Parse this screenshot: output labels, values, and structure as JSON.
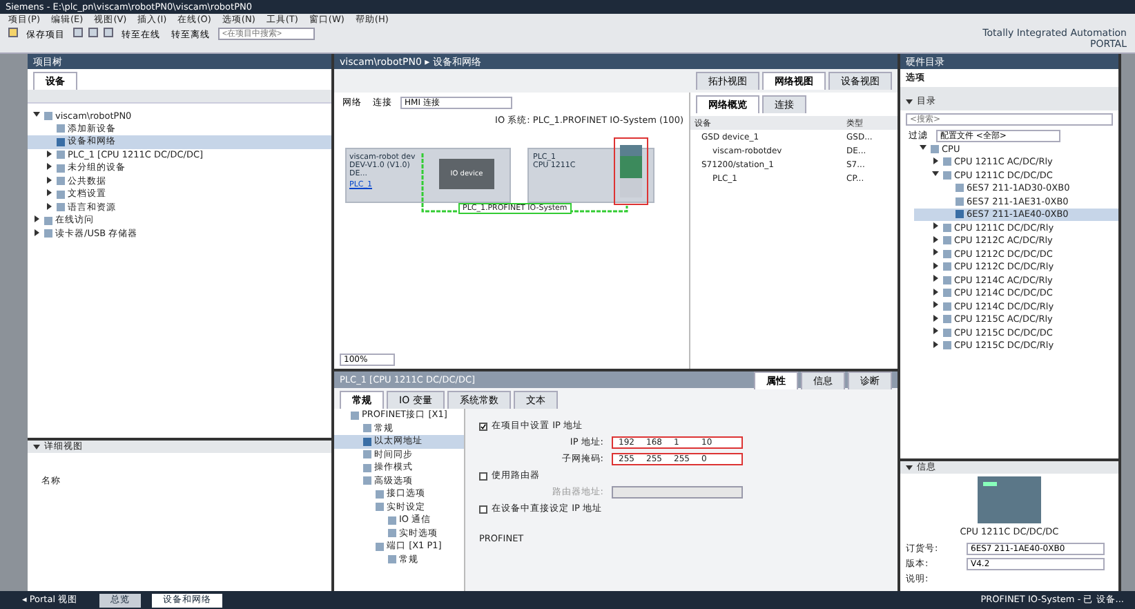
{
  "window": {
    "title": "Siemens - E:\\plc_pn\\viscam\\robotPN0\\viscam\\robotPN0",
    "brand_line1": "Totally Integrated Automation",
    "brand_line2": "PORTAL"
  },
  "menu": [
    "项目(P)",
    "编辑(E)",
    "视图(V)",
    "插入(I)",
    "在线(O)",
    "选项(N)",
    "工具(T)",
    "窗口(W)",
    "帮助(H)"
  ],
  "toolbar": {
    "save_label": "保存项目",
    "online_label": "转至在线",
    "offline_label": "转至离线",
    "search_placeholder": "<在项目中搜索>"
  },
  "project_tree": {
    "title": "项目树",
    "tab": "设备",
    "items": [
      {
        "label": "viscam\\robotPN0",
        "expanded": true,
        "selected": false,
        "children": [
          {
            "label": "添加新设备",
            "selected": false
          },
          {
            "label": "设备和网络",
            "selected": true
          },
          {
            "label": "PLC_1 [CPU 1211C DC/DC/DC]",
            "expanded": false,
            "selected": false
          },
          {
            "label": "未分组的设备",
            "expanded": false,
            "selected": false
          },
          {
            "label": "公共数据",
            "expanded": false,
            "selected": false
          },
          {
            "label": "文档设置",
            "expanded": false,
            "selected": false
          },
          {
            "label": "语言和资源",
            "expanded": false,
            "selected": false
          }
        ]
      },
      {
        "label": "在线访问",
        "expanded": false,
        "selected": false
      },
      {
        "label": "读卡器/USB 存储器",
        "expanded": false,
        "selected": false
      }
    ]
  },
  "details": {
    "title": "详细视图",
    "column": "名称"
  },
  "editor": {
    "breadcrumb": "viscam\\robotPN0 ▸ 设备和网络",
    "view_tabs": [
      {
        "label": "拓扑视图",
        "selected": false
      },
      {
        "label": "网络视图",
        "selected": true
      },
      {
        "label": "设备视图",
        "selected": false
      }
    ],
    "tools": [
      "网络",
      "连接"
    ],
    "connection_select": "HMI 连接",
    "io_system": "IO 系统: PLC_1.PROFINET IO-System (100)",
    "devices": [
      {
        "name": "viscam-robot dev",
        "type": "DEV-V1.0 (V1.0) DE...",
        "link": "PLC_1",
        "module": "IO device"
      },
      {
        "name": "PLC_1",
        "type": "CPU 1211C"
      }
    ],
    "network_label": "PLC_1.PROFINET IO-System",
    "zoom": "100%"
  },
  "overview": {
    "tabs": [
      {
        "label": "网络概览",
        "selected": true
      },
      {
        "label": "连接",
        "selected": false
      }
    ],
    "columns": [
      "设备",
      "类型"
    ],
    "rows": [
      {
        "device": "GSD device_1",
        "type": "GSD..."
      },
      {
        "device": "viscam-robotdev",
        "type": "DE..."
      },
      {
        "device": "S71200/station_1",
        "type": "S7..."
      },
      {
        "device": "PLC_1",
        "type": "CP..."
      }
    ]
  },
  "inspector": {
    "title": "PLC_1 [CPU 1211C DC/DC/DC]",
    "tabs": [
      {
        "label": "属性",
        "selected": true
      },
      {
        "label": "信息",
        "selected": false
      },
      {
        "label": "诊断",
        "selected": false
      }
    ],
    "subtabs": [
      {
        "label": "常规",
        "selected": true
      },
      {
        "label": "IO 变量",
        "selected": false
      },
      {
        "label": "系统常数",
        "selected": false
      },
      {
        "label": "文本",
        "selected": false
      }
    ],
    "nav": [
      {
        "label": "PROFINET接口 [X1]",
        "selected": false,
        "children": [
          {
            "label": "常规",
            "selected": false
          },
          {
            "label": "以太网地址",
            "selected": true
          },
          {
            "label": "时间同步",
            "selected": false
          },
          {
            "label": "操作模式",
            "selected": false
          },
          {
            "label": "高级选项",
            "selected": false,
            "children": [
              {
                "label": "接口选项",
                "selected": false
              },
              {
                "label": "实时设定",
                "selected": false,
                "children": [
                  {
                    "label": "IO 通信",
                    "selected": false
                  },
                  {
                    "label": "实时选项",
                    "selected": false
                  }
                ]
              },
              {
                "label": "端口 [X1 P1]",
                "selected": false,
                "children": [
                  {
                    "label": "常规",
                    "selected": false
                  }
                ]
              }
            ]
          }
        ]
      }
    ],
    "set_ip": {
      "label": "在项目中设置 IP 地址",
      "checked": true
    },
    "ip_label": "IP 地址:",
    "ip": [
      "192",
      "168",
      "1",
      "10"
    ],
    "mask_label": "子网掩码:",
    "mask": [
      "255",
      "255",
      "255",
      "0"
    ],
    "router": {
      "label": "使用路由器",
      "checked": false
    },
    "router_label": "路由器地址:",
    "direct": {
      "label": "在设备中直接设定 IP 地址",
      "checked": false
    },
    "section": "PROFINET"
  },
  "catalog": {
    "title": "硬件目录",
    "options": "选项",
    "section": "目录",
    "search_placeholder": "<搜索>",
    "filter_label": "过滤",
    "profile": "配置文件 <全部>",
    "items": [
      {
        "label": "CPU",
        "expanded": true,
        "selected": false,
        "children": [
          {
            "label": "CPU 1211C AC/DC/Rly",
            "expanded": false,
            "selected": false
          },
          {
            "label": "CPU 1211C DC/DC/DC",
            "expanded": true,
            "selected": false,
            "children": [
              {
                "label": "6ES7 211-1AD30-0XB0",
                "selected": false
              },
              {
                "label": "6ES7 211-1AE31-0XB0",
                "selected": false
              },
              {
                "label": "6ES7 211-1AE40-0XB0",
                "selected": true
              }
            ]
          },
          {
            "label": "CPU 1211C DC/DC/Rly",
            "expanded": false,
            "selected": false
          },
          {
            "label": "CPU 1212C AC/DC/Rly",
            "expanded": false,
            "selected": false
          },
          {
            "label": "CPU 1212C DC/DC/DC",
            "expanded": false,
            "selected": false
          },
          {
            "label": "CPU 1212C DC/DC/Rly",
            "expanded": false,
            "selected": false
          },
          {
            "label": "CPU 1214C AC/DC/Rly",
            "expanded": false,
            "selected": false
          },
          {
            "label": "CPU 1214C DC/DC/DC",
            "expanded": false,
            "selected": false
          },
          {
            "label": "CPU 1214C DC/DC/Rly",
            "expanded": false,
            "selected": false
          },
          {
            "label": "CPU 1215C AC/DC/Rly",
            "expanded": false,
            "selected": false
          },
          {
            "label": "CPU 1215C DC/DC/DC",
            "expanded": false,
            "selected": false
          },
          {
            "label": "CPU 1215C DC/DC/Rly",
            "expanded": false,
            "selected": false
          }
        ]
      }
    ],
    "info_title": "信息",
    "device_name": "CPU 1211C DC/DC/DC",
    "order_label": "订货号:",
    "order": "6ES7 211-1AE40-0XB0",
    "version_label": "版本:",
    "version": "V4.2",
    "desc_label": "说明:"
  },
  "taskbar": {
    "portal": "◂ Portal 视图",
    "tabs": [
      {
        "label": "总览",
        "selected": false
      },
      {
        "label": "设备和网络",
        "selected": true
      }
    ],
    "status": "PROFINET IO-System - 已 设备..."
  }
}
